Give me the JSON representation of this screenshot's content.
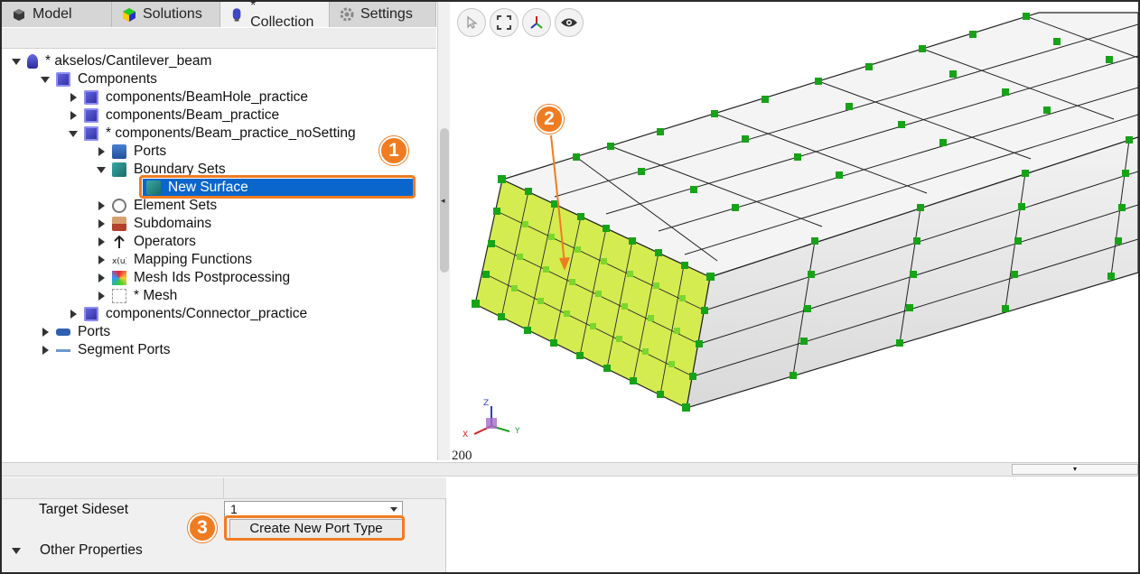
{
  "tabs": [
    {
      "label": "Model",
      "icon": "model-icon"
    },
    {
      "label": "Solutions",
      "icon": "solutions-icon"
    },
    {
      "label": "* Collection",
      "icon": "collection-icon"
    },
    {
      "label": "Settings",
      "icon": "gear-icon"
    }
  ],
  "tree": {
    "root": "* akselos/Cantilever_beam",
    "components": "Components",
    "beamhole": "components/BeamHole_practice",
    "beam": "components/Beam_practice",
    "beam_nosetting": "* components/Beam_practice_noSetting",
    "ports": "Ports",
    "boundary_sets": "Boundary Sets",
    "new_surface": "New Surface",
    "element_sets": "Element Sets",
    "subdomains": "Subdomains",
    "operators": "Operators",
    "mapping_functions": "Mapping Functions",
    "mesh_ids": "Mesh Ids Postprocessing",
    "mesh": "* Mesh",
    "connector": "components/Connector_practice",
    "top_ports": "Ports",
    "segment_ports": "Segment Ports"
  },
  "viewport": {
    "scale_label": "200",
    "axes": {
      "x": "X",
      "y": "Y",
      "z": "Z"
    },
    "toolbar": [
      "select-icon",
      "fit-view-icon",
      "axes-icon",
      "eye-icon"
    ]
  },
  "properties": {
    "target_sideset_label": "Target Sideset",
    "target_sideset_value": "1",
    "create_button": "Create New Port Type",
    "other_properties": "Other Properties"
  },
  "annotations": {
    "badge1": "1",
    "badge2": "2",
    "badge3": "3"
  },
  "colors": {
    "accent": "#f07c22",
    "selection": "#0a66cc",
    "face": "#d4ec50",
    "node": "#1aa31a"
  }
}
